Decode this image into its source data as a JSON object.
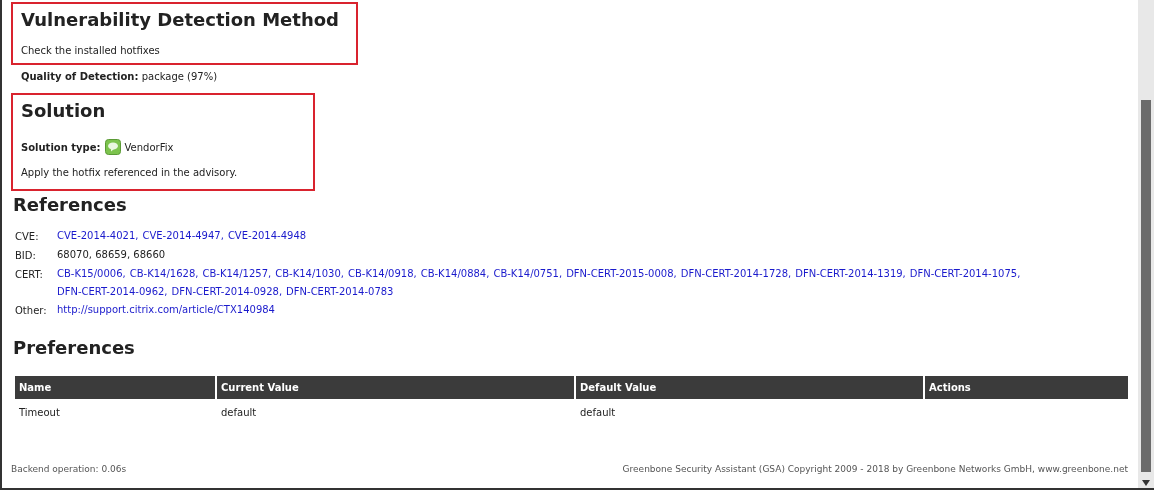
{
  "detection": {
    "heading": "Vulnerability Detection Method",
    "text": "Check the installed hotfixes",
    "highlighted": true
  },
  "quality": {
    "label": "Quality of Detection:",
    "value": "package (97%)"
  },
  "solution": {
    "heading": "Solution",
    "type_label": "Solution type:",
    "type_value": "VendorFix",
    "text": "Apply the hotfix referenced in the advisory.",
    "highlighted": true
  },
  "references": {
    "heading": "References",
    "rows": [
      {
        "label": "CVE:",
        "kind": "links",
        "items": [
          "CVE-2014-4021,",
          "CVE-2014-4947,",
          "CVE-2014-4948"
        ]
      },
      {
        "label": "BID:",
        "kind": "text",
        "items": [
          "68070, 68659, 68660"
        ]
      },
      {
        "label": "CERT:",
        "kind": "links",
        "items": [
          "CB-K15/0006,",
          "CB-K14/1628,",
          "CB-K14/1257,",
          "CB-K14/1030,",
          "CB-K14/0918,",
          "CB-K14/0884,",
          "CB-K14/0751,",
          "DFN-CERT-2015-0008,",
          "DFN-CERT-2014-1728,",
          "DFN-CERT-2014-1319,",
          "DFN-CERT-2014-1075,",
          "DFN-CERT-2014-0962,",
          "DFN-CERT-2014-0928,",
          "DFN-CERT-2014-0783"
        ]
      },
      {
        "label": "Other:",
        "kind": "links",
        "items": [
          "http://support.citrix.com/article/CTX140984"
        ]
      }
    ]
  },
  "preferences": {
    "heading": "Preferences",
    "columns": [
      "Name",
      "Current Value",
      "Default Value",
      "Actions"
    ],
    "rows": [
      [
        "Timeout",
        "default",
        "default",
        ""
      ]
    ]
  },
  "footer": {
    "left": "Backend operation: 0.06s",
    "right": "Greenbone Security Assistant (GSA) Copyright 2009 - 2018 by Greenbone Networks GmbH, www.greenbone.net"
  }
}
